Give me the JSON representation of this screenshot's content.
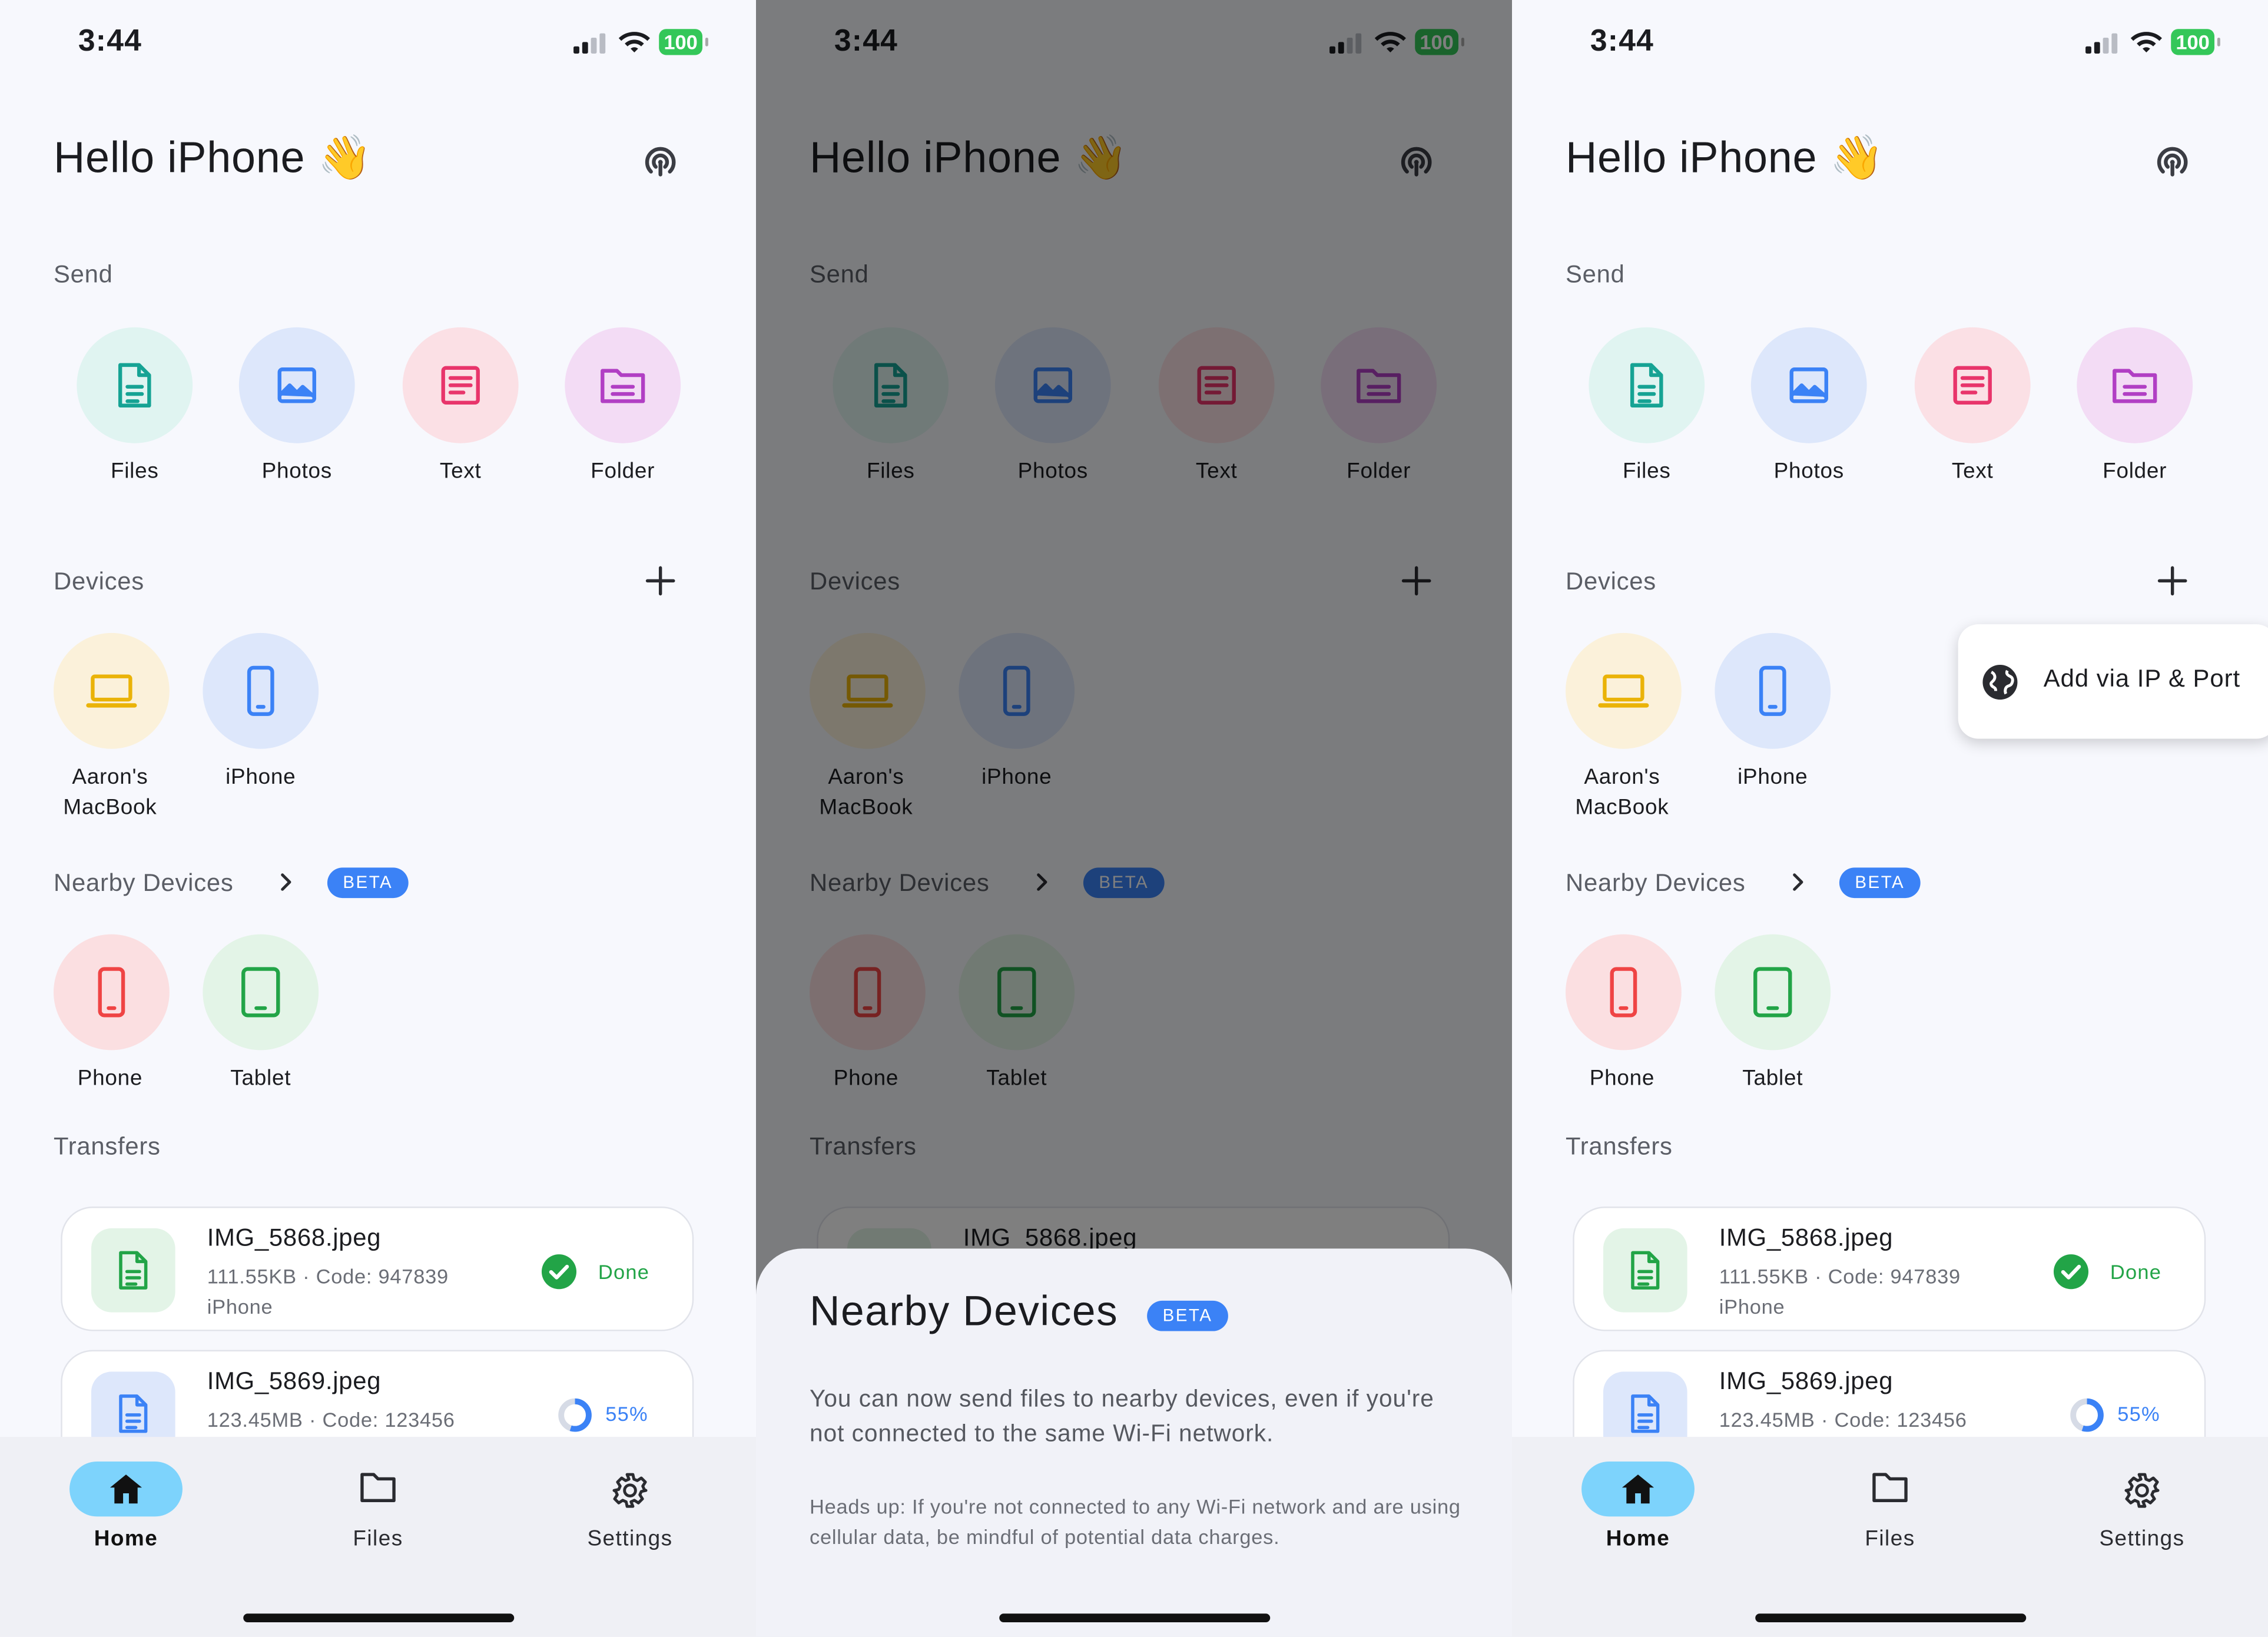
{
  "status": {
    "time": "3:44",
    "battery": "100"
  },
  "home": {
    "greeting": "Hello iPhone 👋",
    "send_label": "Send",
    "send_items": [
      {
        "label": "Files",
        "icon": "file-icon"
      },
      {
        "label": "Photos",
        "icon": "image-icon"
      },
      {
        "label": "Text",
        "icon": "text-icon"
      },
      {
        "label": "Folder",
        "icon": "folder-icon"
      }
    ],
    "devices_label": "Devices",
    "devices": [
      {
        "label": "Aaron's MacBook",
        "icon": "laptop-icon"
      },
      {
        "label": "iPhone",
        "icon": "smartphone-icon"
      }
    ],
    "nearby_label": "Nearby Devices",
    "beta_label": "BETA",
    "nearby": [
      {
        "label": "Phone",
        "icon": "smartphone-icon"
      },
      {
        "label": "Tablet",
        "icon": "tablet-icon"
      }
    ],
    "transfers_label": "Transfers",
    "transfers": [
      {
        "name": "IMG_5868.jpeg",
        "meta": "111.55KB · Code: 947839",
        "device": "iPhone",
        "status": "Done"
      },
      {
        "name": "IMG_5869.jpeg",
        "meta": "123.45MB · Code: 123456",
        "status": "55%",
        "progress": 0.55
      }
    ]
  },
  "nav": {
    "home": "Home",
    "files": "Files",
    "settings": "Settings"
  },
  "sheet": {
    "title": "Nearby Devices",
    "beta": "BETA",
    "body": "You can now send files to nearby devices, even if you're not connected to the same Wi-Fi network.",
    "note": "Heads up: If you're not connected to any Wi-Fi network and are using cellular data, be mindful of potential data charges."
  },
  "popup": {
    "label": "Add via IP & Port"
  },
  "colors": {
    "accent": "#3b82f6",
    "done": "#22a447",
    "progress": "#3b82f6",
    "nav_active": "#7dd3fc",
    "battery": "#34c759"
  }
}
